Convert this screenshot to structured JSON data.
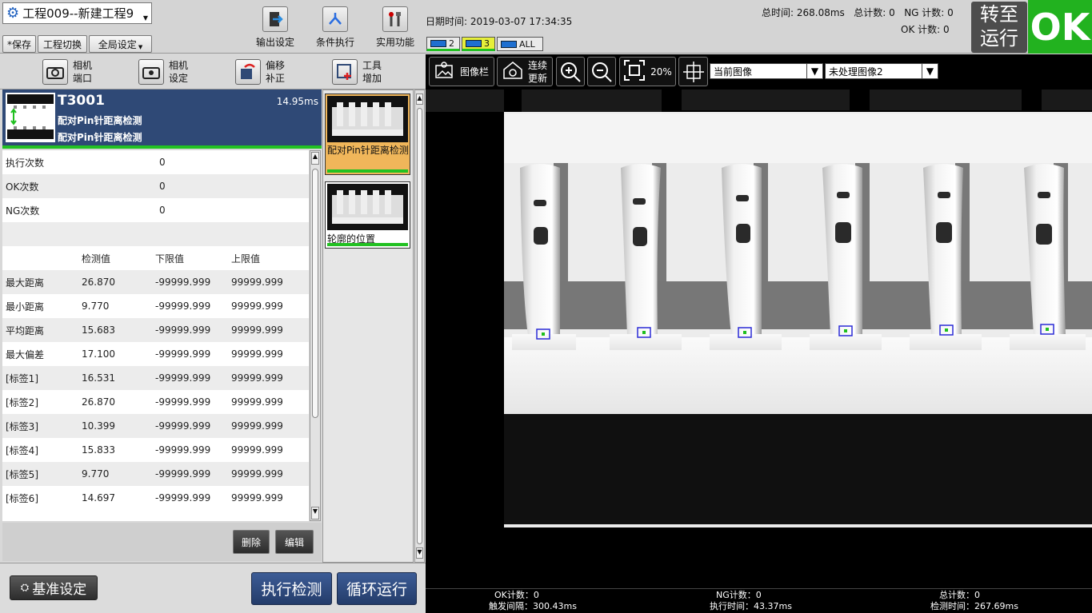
{
  "project": {
    "title": "工程009--新建工程9"
  },
  "menu": {
    "save": "*保存",
    "switch": "工程切换",
    "global": "全局设定"
  },
  "tools": {
    "output": "输出设定",
    "condition": "条件执行",
    "utility": "实用功能"
  },
  "datetime": "日期时间: 2019-03-07 17:34:35",
  "chips": [
    "2",
    "3",
    "ALL"
  ],
  "stats": {
    "total_time": "总时间: 268.08ms",
    "total_count": "总计数: 0",
    "ng_count": "NG 计数: 0",
    "ok_count": "OK 计数: 0"
  },
  "switch_run": {
    "line1": "转至",
    "line2": "运行"
  },
  "result": "OK",
  "toolbar2": [
    {
      "l1": "相机",
      "l2": "端口"
    },
    {
      "l1": "相机",
      "l2": "设定"
    },
    {
      "l1": "偏移",
      "l2": "补正"
    },
    {
      "l1": "工具",
      "l2": "增加"
    }
  ],
  "tool": {
    "id": "T3001",
    "name1": "配对Pin针距离检测",
    "name2": "配对Pin针距离检测",
    "time": "14.95ms"
  },
  "counts": [
    {
      "label": "执行次数",
      "value": "0"
    },
    {
      "label": "OK次数",
      "value": "0"
    },
    {
      "label": "NG次数",
      "value": "0"
    }
  ],
  "table": {
    "headers": [
      "",
      "检测值",
      "下限值",
      "上限值"
    ],
    "rows": [
      [
        "最大距离",
        "26.870",
        "-99999.999",
        "99999.999"
      ],
      [
        "最小距离",
        "9.770",
        "-99999.999",
        "99999.999"
      ],
      [
        "平均距离",
        "15.683",
        "-99999.999",
        "99999.999"
      ],
      [
        "最大偏差",
        "17.100",
        "-99999.999",
        "99999.999"
      ],
      [
        "[标签1]",
        "16.531",
        "-99999.999",
        "99999.999"
      ],
      [
        "[标签2]",
        "26.870",
        "-99999.999",
        "99999.999"
      ],
      [
        "[标签3]",
        "10.399",
        "-99999.999",
        "99999.999"
      ],
      [
        "[标签4]",
        "15.833",
        "-99999.999",
        "99999.999"
      ],
      [
        "[标签5]",
        "9.770",
        "-99999.999",
        "99999.999"
      ],
      [
        "[标签6]",
        "14.697",
        "-99999.999",
        "99999.999"
      ]
    ]
  },
  "actions": {
    "delete": "删除",
    "edit": "编辑"
  },
  "side_tools": [
    {
      "label": "配对Pin针距离检测"
    },
    {
      "label": "轮廓的位置"
    }
  ],
  "footer_buttons": {
    "baseline": "基准设定",
    "execute": "执行检测",
    "loop": "循环运行"
  },
  "imgtools": {
    "image_bar": "图像栏",
    "cont1": "连续",
    "cont2": "更新",
    "zoom": "20%"
  },
  "selects": {
    "current": "当前图像",
    "raw": "未处理图像2"
  },
  "footer": {
    "ok": "OK计数：0",
    "trigger": "触发间隔：300.43ms",
    "ng": "NG计数：0",
    "exec": "执行时间：43.37ms",
    "total": "总计数：0",
    "detect": "检测时间：267.69ms"
  },
  "colors": {
    "header_blue": "#2f4976",
    "ok_green": "#22b21f",
    "selected_tool": "#f0b65a"
  }
}
